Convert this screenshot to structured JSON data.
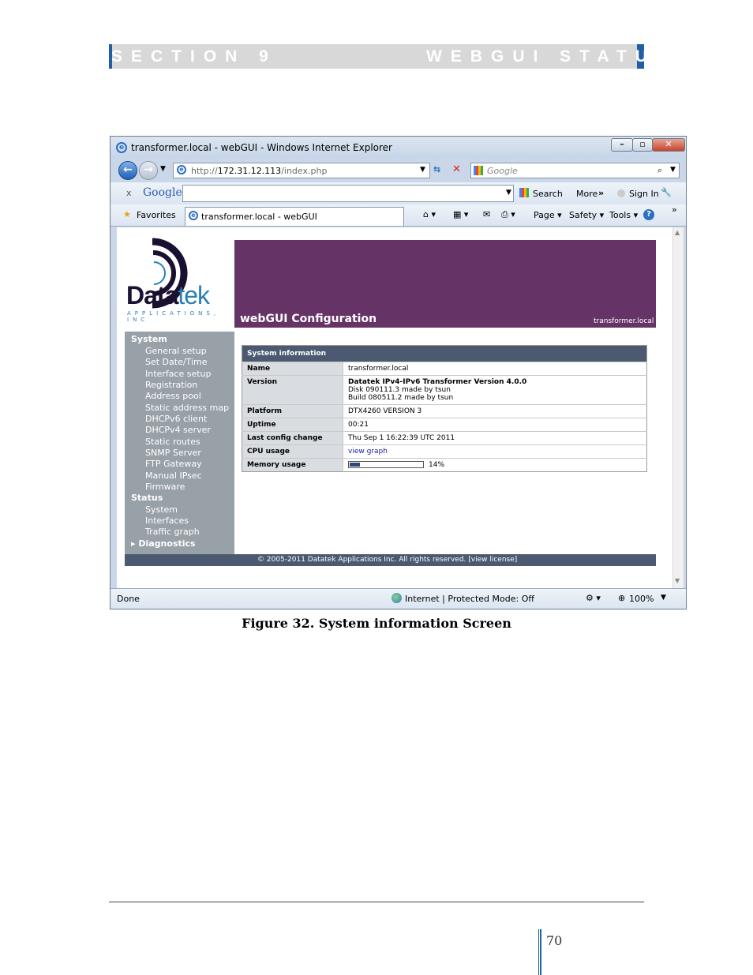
{
  "header": {
    "section": "SECTION 9",
    "title": "WEBGUI STATUS"
  },
  "browser": {
    "window_title": "transformer.local - webGUI - Windows Internet Explorer",
    "url_prefix": "http://",
    "url_host": "172.31.12.113",
    "url_path": "/index.php",
    "search_placeholder": "Google",
    "google_toolbar": {
      "close": "x",
      "logo": "Google",
      "search": "Search",
      "more": "More",
      "more_arrows": "»",
      "sign_in": "Sign In"
    },
    "favorites_label": "Favorites",
    "tab_label": "transformer.local - webGUI",
    "command_bar": {
      "page": "Page",
      "safety": "Safety",
      "tools": "Tools"
    },
    "status": {
      "left": "Done",
      "zone": "Internet | Protected Mode: Off",
      "zoom": "100%"
    },
    "window_buttons": {
      "minimize": "–",
      "maximize": "▫",
      "close": "✕"
    }
  },
  "webgui": {
    "logo": {
      "brand_a": "Data",
      "brand_b": "tek",
      "tagline": "APPLICATIONS, INC"
    },
    "title": "webGUI Configuration",
    "host": "transformer.local",
    "sidebar": {
      "system_head": "System",
      "system_items": [
        "General setup",
        "Set Date/Time",
        "Interface setup",
        "Registration",
        "Address pool",
        "Static address map",
        "DHCPv6 client",
        "DHCPv4 server",
        "Static routes",
        "SNMP Server",
        "FTP Gateway",
        "Manual IPsec",
        "Firmware"
      ],
      "status_head": "Status",
      "status_items": [
        "System",
        "Interfaces",
        "Traffic graph"
      ],
      "diag_head": "Diagnostics"
    },
    "info": {
      "heading": "System information",
      "name_label": "Name",
      "name_value": "transformer.local",
      "version_label": "Version",
      "version_line1": "Datatek IPv4-IPv6 Transformer Version 4.0.0",
      "version_line2": "Disk 090111.3 made by tsun",
      "version_line3": "Build 080511.2 made by tsun",
      "platform_label": "Platform",
      "platform_value": "DTX4260 VERSION 3",
      "uptime_label": "Uptime",
      "uptime_value": "00:21",
      "lastcfg_label": "Last config change",
      "lastcfg_value": "Thu Sep 1 16:22:39 UTC 2011",
      "cpu_label": "CPU usage",
      "cpu_value": "view graph",
      "mem_label": "Memory usage",
      "mem_value": "14%",
      "mem_fraction": 0.14
    },
    "footer": "© 2005-2011 Datatek Applications Inc. All rights reserved.   [view license]"
  },
  "caption": "Figure 32. System information Screen",
  "page_number": "70",
  "colors": {
    "accent_blue": "#1f5fa6",
    "banner_purple": "#663366",
    "sidebar_gray": "#99a1a8",
    "header_slate": "#4b5a70"
  }
}
